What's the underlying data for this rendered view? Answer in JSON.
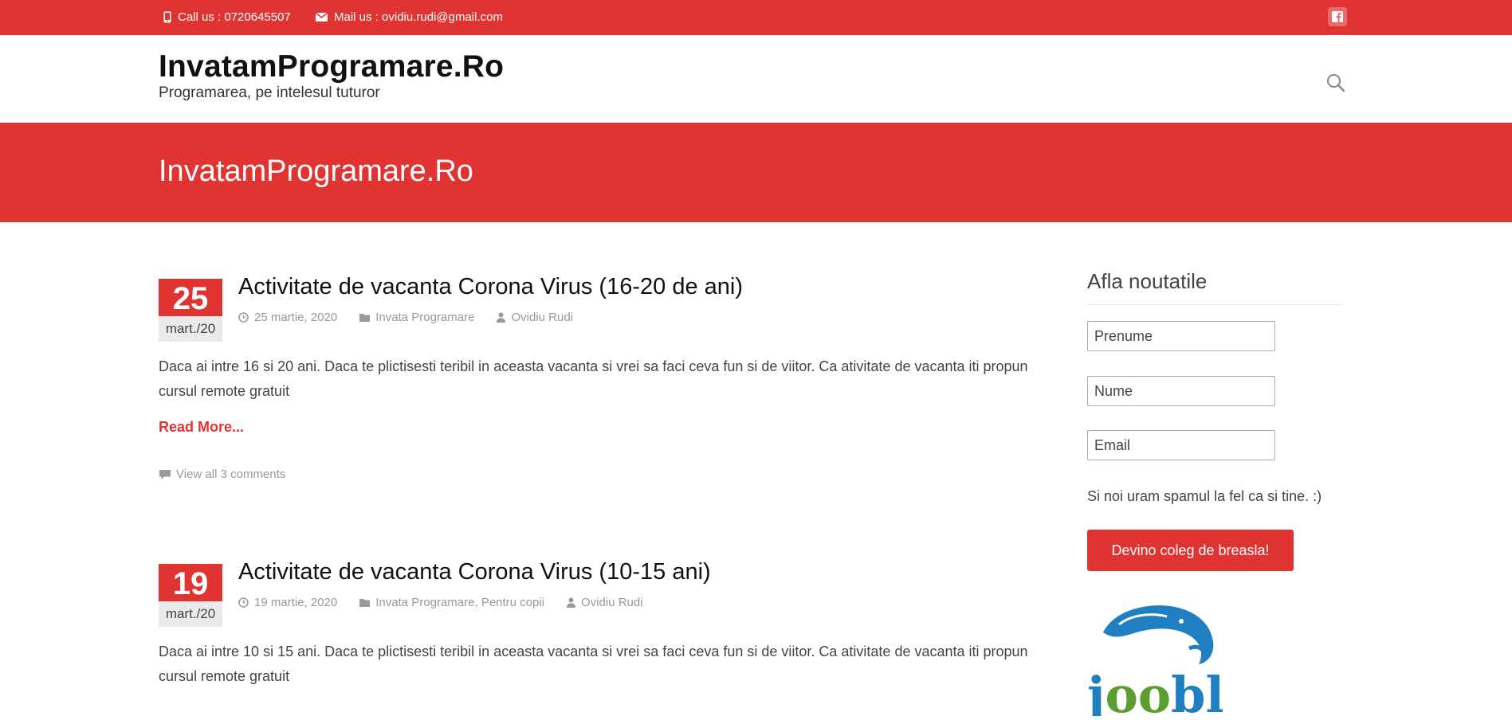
{
  "topbar": {
    "phone": "Call us : 0720645507",
    "mail": "Mail us : ovidiu.rudi@gmail.com",
    "social_icon": "facebook-icon"
  },
  "header": {
    "title": "InvatamProgramare.Ro",
    "tagline": "Programarea, pe intelesul tuturor",
    "search_icon": "search-icon"
  },
  "banner": {
    "title": "InvatamProgramare.Ro"
  },
  "posts": [
    {
      "day": "25",
      "month": "mart./20",
      "title": "Activitate de vacanta Corona Virus (16-20 de ani)",
      "date": "25 martie, 2020",
      "categories": [
        "Invata Programare"
      ],
      "author": "Ovidiu Rudi",
      "excerpt": "Daca ai intre 16 si 20 ani. Daca te plictisesti teribil in aceasta vacanta si vrei sa faci ceva fun si de viitor. Ca ativitate de vacanta iti propun cursul remote gratuit",
      "read_more": "Read More...",
      "comments": "View all 3 comments"
    },
    {
      "day": "19",
      "month": "mart./20",
      "title": "Activitate de vacanta Corona Virus (10-15 ani)",
      "date": "19 martie, 2020",
      "categories": [
        "Invata Programare",
        "Pentru copii"
      ],
      "author": "Ovidiu Rudi",
      "excerpt": "Daca ai intre 10 si 15 ani. Daca te plictisesti teribil in aceasta vacanta si vrei sa faci ceva fun si de viitor. Ca ativitate de vacanta iti propun cursul remote gratuit"
    }
  ],
  "sidebar": {
    "title": "Afla noutatile",
    "first_name_placeholder": "Prenume",
    "last_name_placeholder": "Nume",
    "email_placeholder": "Email",
    "note": "Si noi uram spamul la fel ca si tine. :)",
    "button": "Devino coleg de breasla!",
    "logo_text": "jooble"
  },
  "colors": {
    "accent": "#e03433",
    "gray_text": "#999999"
  }
}
